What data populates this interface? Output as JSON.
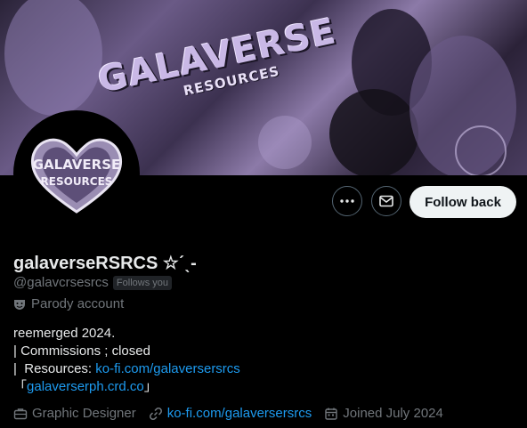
{
  "banner": {
    "title": "GALAVERSE",
    "subtitle": "RESOURCES"
  },
  "avatar": {
    "text_top": "GALAVERSE",
    "text_bottom": "RESOURCES"
  },
  "actions": {
    "more_icon": "more-horizontal-icon",
    "message_icon": "envelope-icon",
    "follow_label": "Follow back"
  },
  "profile": {
    "display_name": "galaverseRSRCS ☆ˊˎ-",
    "handle": "@galavcrsesrcs",
    "follows_you": "Follows you",
    "parody_label": "Parody account"
  },
  "bio": {
    "line1": "reemerged 2024.",
    "line2_prefix": "|  Commissions ; closed",
    "line3_prefix": "|  Resources: ",
    "line3_link": "ko-fi.com/galaversersrcs",
    "line4_open": "「",
    "line4_link": "galaverserph.crd.co",
    "line4_close": "」"
  },
  "meta": {
    "profession": "Graphic Designer",
    "website": "ko-fi.com/galaversersrcs",
    "joined": "Joined July 2024"
  },
  "colors": {
    "background": "#000000",
    "text_primary": "#e7e9ea",
    "text_secondary": "#71767b",
    "link": "#1d9bf0",
    "follow_button_bg": "#eff3f4"
  }
}
